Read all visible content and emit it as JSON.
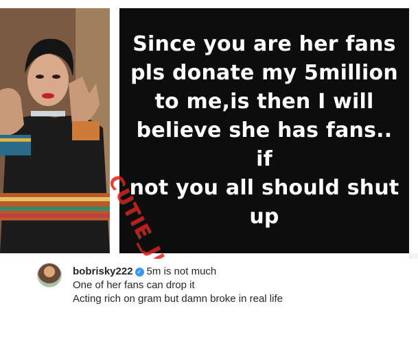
{
  "post": {
    "quote_lines": [
      "Since you are her fans",
      "pls donate my 5million",
      "to me,is then I will",
      "believe she has fans.. if",
      "not you all should shut",
      "up"
    ],
    "watermark": "CUTIE_JULS"
  },
  "comment": {
    "username": "bobrisky222",
    "verified_icon": "verified-badge-icon",
    "line1": "5m is not much",
    "line2": "One of her fans can drop it",
    "line3": "Acting rich on gram but damn broke in real life"
  },
  "colors": {
    "quote_background": "#0d0d0d",
    "quote_text": "#ffffff",
    "watermark": "#e0201a",
    "verified": "#3897f0"
  }
}
